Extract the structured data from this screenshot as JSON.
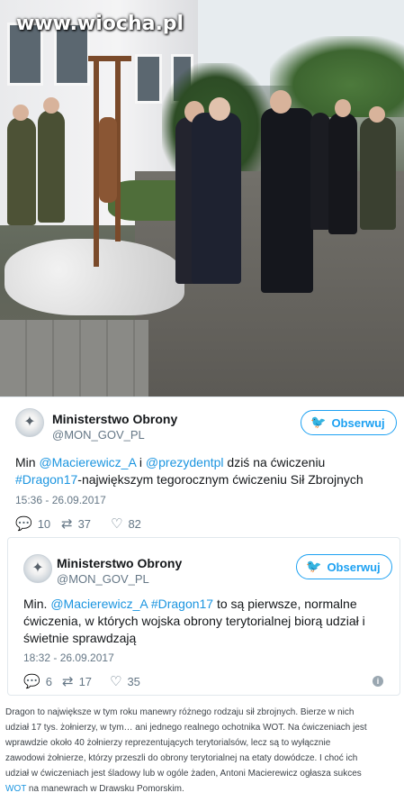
{
  "watermark": "www.wiocha.pl",
  "tweet": {
    "author_name": "Ministerstwo Obrony",
    "author_handle": "@MON_GOV_PL",
    "follow_label": "Obserwuj",
    "text_prefix": "Min ",
    "mention1": "@Macierewicz_A",
    "text_and": " i ",
    "mention2": "@prezydentpl",
    "text_mid": " dziś na ćwiczeniu",
    "hashtag": "#Dragon17",
    "text_suffix": "-największym tegorocznym ćwiczeniu Sił Zbrojnych",
    "timestamp": "15:36 - 26.09.2017",
    "replies": "10",
    "retweets": "37",
    "likes": "82"
  },
  "quoted_tweet": {
    "author_name": "Ministerstwo Obrony",
    "author_handle": "@MON_GOV_PL",
    "follow_label": "Obserwuj",
    "text_prefix": "Min. ",
    "mention": "@Macierewicz_A",
    "text_space": " ",
    "hashtag": "#Dragon17",
    "text_line1": " to są pierwsze, normalne",
    "text_line2": "ćwiczenia, w których wojska obrony terytorialnej biorą udział i",
    "text_line3": "świetnie sprawdzają",
    "timestamp": "18:32 - 26.09.2017",
    "replies": "6",
    "retweets": "17",
    "likes": "35",
    "info_icon_label": "i"
  },
  "article": {
    "line1": "Dragon to największe w tym roku manewry różnego rodzaju sił zbrojnych. Bierze w nich",
    "line2": "udział 17 tys. żołnierzy, w tym… ani jednego realnego ochotnika WOT. Na ćwiczeniach jest",
    "line3": "wprawdzie około 40 żołnierzy reprezentujących terytorialsów, lecz są to wyłącznie",
    "line4": "zawodowi żołnierze, którzy przeszli do obrony terytorialnej na etaty dowódcze. I choć ich",
    "line5": "udział w ćwiczeniach jest śladowy lub w ogóle żaden, Antoni Macierewicz ogłasza sukces",
    "line6_hl": "WOT",
    "line6_rest": " na manewrach w Drawsku Pomorskim."
  },
  "colors": {
    "twitter_blue": "#1da1f2",
    "link_blue": "#1b95e0",
    "muted_gray": "#657786"
  },
  "icons": {
    "reply": "reply-icon",
    "retweet": "retweet-icon",
    "like": "heart-icon",
    "bird": "twitter-bird-icon",
    "info": "info-icon"
  }
}
